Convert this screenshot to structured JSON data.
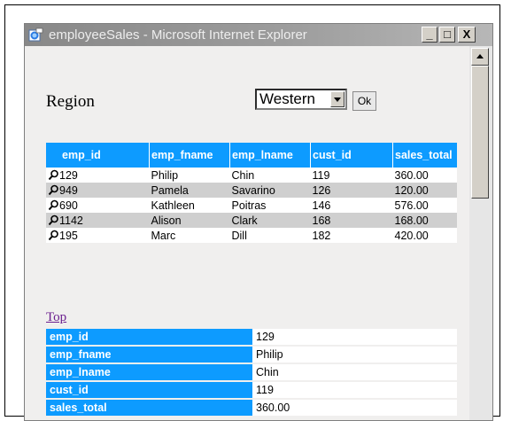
{
  "window": {
    "title": "employeeSales - Microsoft Internet Explorer",
    "minimize": "_",
    "maximize": "□",
    "close": "X"
  },
  "region": {
    "label": "Region",
    "selected": "Western",
    "ok_label": "Ok"
  },
  "sales_table": {
    "headers": [
      "emp_id",
      "emp_fname",
      "emp_lname",
      "cust_id",
      "sales_total"
    ],
    "rows": [
      [
        "129",
        "Philip",
        "Chin",
        "119",
        "360.00"
      ],
      [
        "949",
        "Pamela",
        "Savarino",
        "126",
        "120.00"
      ],
      [
        "690",
        "Kathleen",
        "Poitras",
        "146",
        "576.00"
      ],
      [
        "1142",
        "Alison",
        "Clark",
        "168",
        "168.00"
      ],
      [
        "195",
        "Marc",
        "Dill",
        "182",
        "420.00"
      ]
    ]
  },
  "top_link": "Top",
  "detail": {
    "rows": [
      {
        "key": "emp_id",
        "value": "129"
      },
      {
        "key": "emp_fname",
        "value": "Philip"
      },
      {
        "key": "emp_lname",
        "value": "Chin"
      },
      {
        "key": "cust_id",
        "value": "119"
      },
      {
        "key": "sales_total",
        "value": "360.00"
      }
    ]
  },
  "colors": {
    "header_blue": "#0d9bff",
    "alt_row": "#cfcfcf",
    "link": "#6b1f8f"
  },
  "icons": [
    "ie-logo-icon",
    "minimize-icon",
    "maximize-icon",
    "close-icon",
    "magnifier-icon",
    "scroll-up-icon",
    "dropdown-arrow-icon"
  ]
}
